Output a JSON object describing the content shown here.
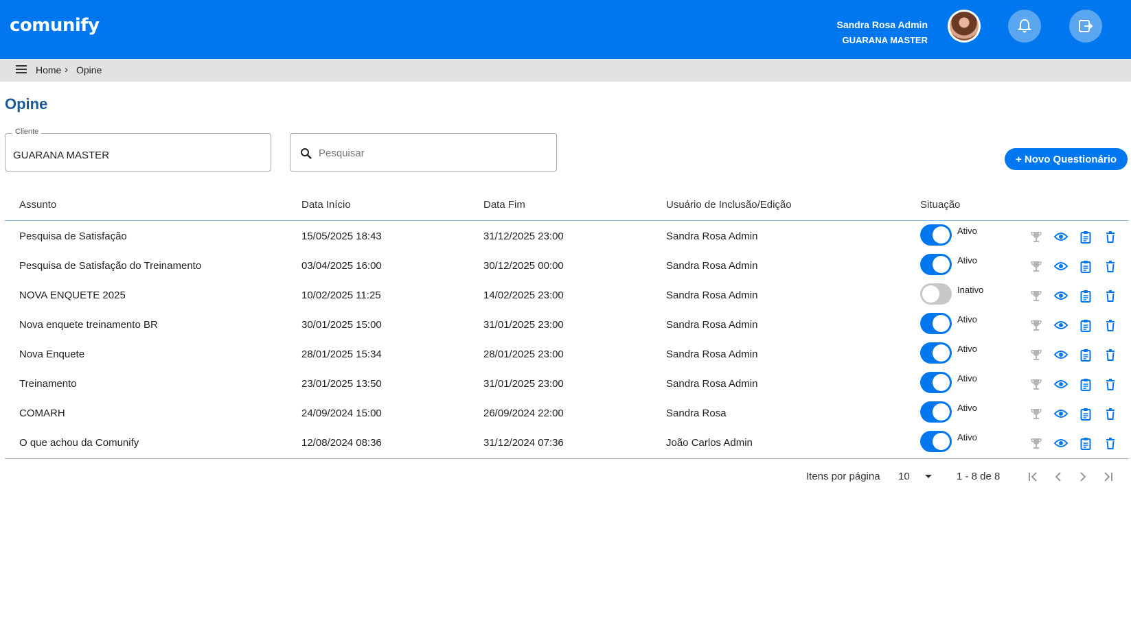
{
  "app": {
    "logo": "comunify"
  },
  "header": {
    "user_name": "Sandra Rosa Admin",
    "user_company": "GUARANA MASTER",
    "avatar_icon": "user-avatar",
    "notification_icon": "bell-icon",
    "logout_icon": "logout-icon",
    "color": "#0077ee"
  },
  "breadcrumb": {
    "home": "Home",
    "current": "Opine"
  },
  "page": {
    "title": "Opine"
  },
  "filters": {
    "client_label": "Cliente",
    "client_value": "GUARANA MASTER",
    "search_placeholder": "Pesquisar",
    "search_value": ""
  },
  "actions": {
    "new_button": "+ Novo Questionário"
  },
  "table": {
    "columns": [
      "Assunto",
      "Data Início",
      "Data Fim",
      "Usuário de Inclusão/Edição",
      "Situação"
    ],
    "rows": [
      {
        "subject": "Pesquisa de Satisfação",
        "start": "15/05/2025 18:43",
        "end": "31/12/2025 23:00",
        "user": "Sandra Rosa Admin",
        "status": "Ativo",
        "active": true
      },
      {
        "subject": "Pesquisa de Satisfação do Treinamento",
        "start": "03/04/2025 16:00",
        "end": "30/12/2025 00:00",
        "user": "Sandra Rosa Admin",
        "status": "Ativo",
        "active": true
      },
      {
        "subject": "NOVA ENQUETE 2025",
        "start": "10/02/2025 11:25",
        "end": "14/02/2025 23:00",
        "user": "Sandra Rosa Admin",
        "status": "Inativo",
        "active": false
      },
      {
        "subject": "Nova enquete treinamento BR",
        "start": "30/01/2025 15:00",
        "end": "31/01/2025 23:00",
        "user": "Sandra Rosa Admin",
        "status": "Ativo",
        "active": true
      },
      {
        "subject": "Nova Enquete",
        "start": "28/01/2025 15:34",
        "end": "28/01/2025 23:00",
        "user": "Sandra Rosa Admin",
        "status": "Ativo",
        "active": true
      },
      {
        "subject": "Treinamento",
        "start": "23/01/2025 13:50",
        "end": "31/01/2025 23:00",
        "user": "Sandra Rosa Admin",
        "status": "Ativo",
        "active": true
      },
      {
        "subject": "COMARH",
        "start": "24/09/2024 15:00",
        "end": "26/09/2024 22:00",
        "user": "Sandra Rosa",
        "status": "Ativo",
        "active": true
      },
      {
        "subject": "O que achou da Comunify",
        "start": "12/08/2024 08:36",
        "end": "31/12/2024 07:36",
        "user": "João Carlos Admin",
        "status": "Ativo",
        "active": true
      }
    ],
    "row_action_icons": [
      "trophy-icon",
      "eye-icon",
      "clipboard-icon",
      "trash-icon"
    ]
  },
  "pagination": {
    "items_per_page_label": "Itens por página",
    "items_per_page": "10",
    "range": "1 - 8 de 8"
  }
}
